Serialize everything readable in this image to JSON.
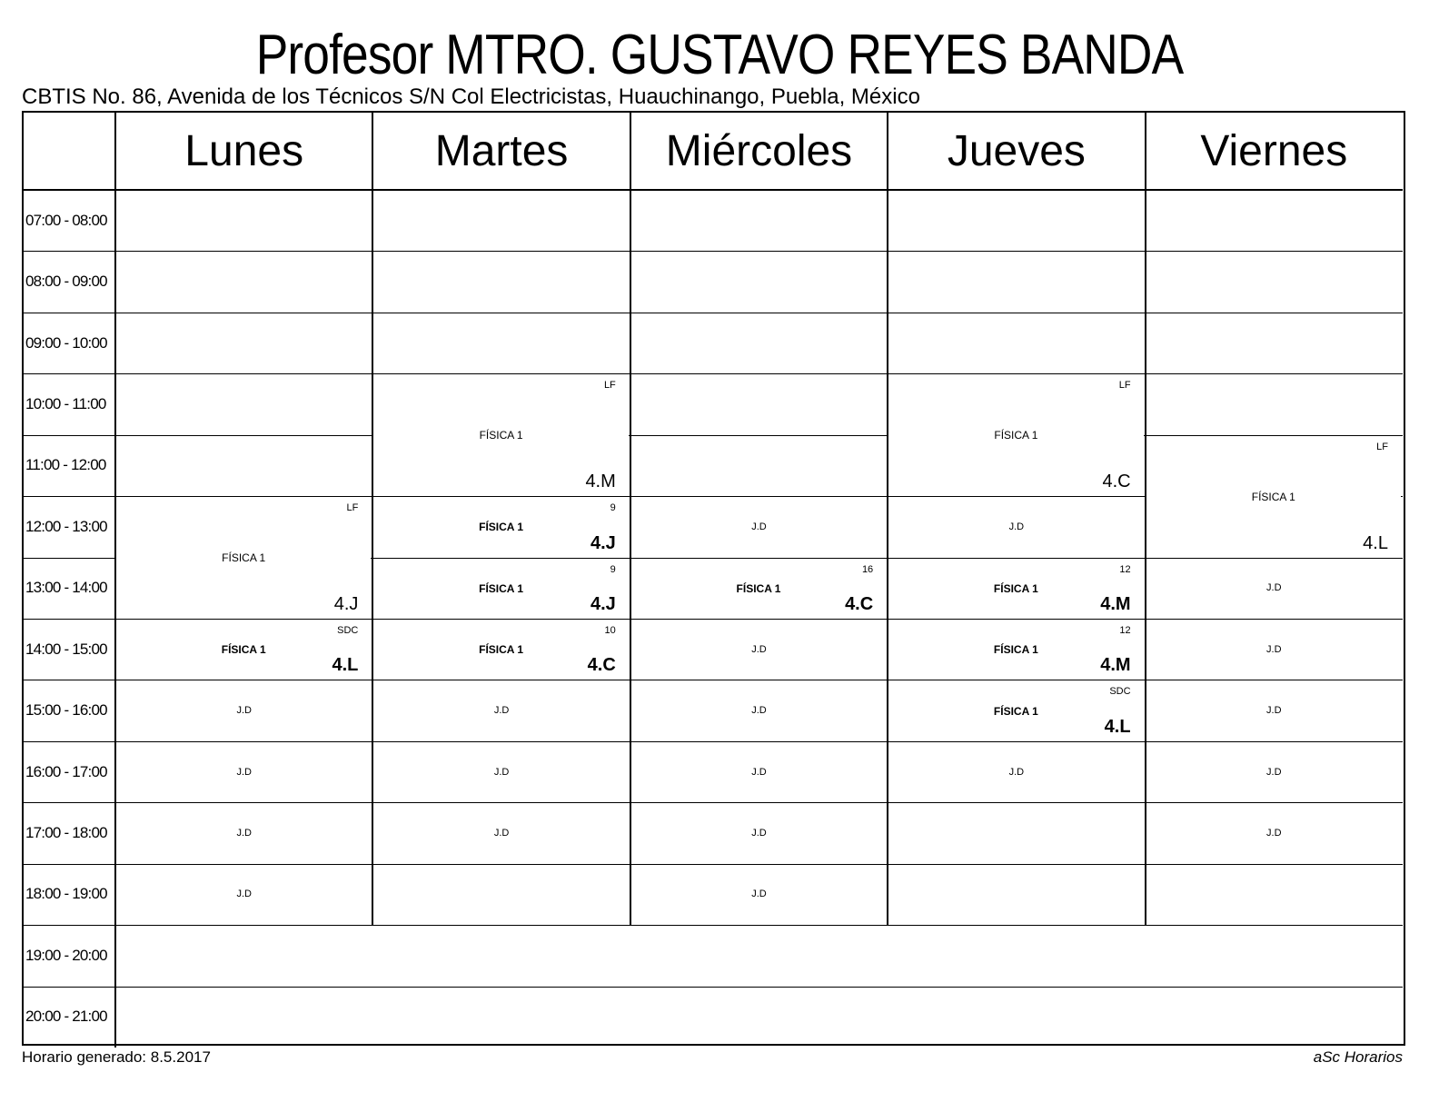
{
  "header": {
    "title": "Profesor MTRO. GUSTAVO REYES BANDA",
    "subtitle": "CBTIS No. 86, Avenida de los Técnicos S/N Col Electricistas, Huauchinango, Puebla, México"
  },
  "days": [
    "Lunes",
    "Martes",
    "Miércoles",
    "Jueves",
    "Viernes"
  ],
  "times": [
    "07:00 - 08:00",
    "08:00 - 09:00",
    "09:00 - 10:00",
    "10:00 - 11:00",
    "11:00 - 12:00",
    "12:00 - 13:00",
    "13:00 - 14:00",
    "14:00 - 15:00",
    "15:00 - 16:00",
    "16:00 - 17:00",
    "17:00 - 18:00",
    "18:00 - 19:00",
    "19:00 - 20:00",
    "20:00 - 21:00"
  ],
  "grid_rows": 12,
  "lessons": [
    {
      "day": 1,
      "start": 3,
      "span": 2,
      "subject": "FÍSICA 1",
      "room": "LF",
      "group": "4.M",
      "bold": false
    },
    {
      "day": 3,
      "start": 3,
      "span": 2,
      "subject": "FÍSICA 1",
      "room": "LF",
      "group": "4.C",
      "bold": false
    },
    {
      "day": 4,
      "start": 4,
      "span": 2,
      "subject": "FÍSICA 1",
      "room": "LF",
      "group": "4.L",
      "bold": false
    },
    {
      "day": 0,
      "start": 5,
      "span": 2,
      "subject": "FÍSICA 1",
      "room": "LF",
      "group": "4.J",
      "bold": false
    },
    {
      "day": 1,
      "start": 5,
      "span": 1,
      "subject": "FÍSICA 1",
      "room": "9",
      "group": "4.J",
      "bold": true
    },
    {
      "day": 1,
      "start": 6,
      "span": 1,
      "subject": "FÍSICA 1",
      "room": "9",
      "group": "4.J",
      "bold": true
    },
    {
      "day": 2,
      "start": 6,
      "span": 1,
      "subject": "FÍSICA 1",
      "room": "16",
      "group": "4.C",
      "bold": true
    },
    {
      "day": 3,
      "start": 6,
      "span": 1,
      "subject": "FÍSICA 1",
      "room": "12",
      "group": "4.M",
      "bold": true
    },
    {
      "day": 0,
      "start": 7,
      "span": 1,
      "subject": "FÍSICA 1",
      "room": "SDC",
      "group": "4.L",
      "bold": true
    },
    {
      "day": 1,
      "start": 7,
      "span": 1,
      "subject": "FÍSICA 1",
      "room": "10",
      "group": "4.C",
      "bold": true
    },
    {
      "day": 3,
      "start": 7,
      "span": 1,
      "subject": "FÍSICA 1",
      "room": "12",
      "group": "4.M",
      "bold": true
    },
    {
      "day": 3,
      "start": 8,
      "span": 1,
      "subject": "FÍSICA 1",
      "room": "SDC",
      "group": "4.L",
      "bold": true
    }
  ],
  "duties": [
    {
      "day": 2,
      "row": 5,
      "label": "J.D"
    },
    {
      "day": 3,
      "row": 5,
      "label": "J.D"
    },
    {
      "day": 4,
      "row": 6,
      "label": "J.D"
    },
    {
      "day": 2,
      "row": 7,
      "label": "J.D"
    },
    {
      "day": 4,
      "row": 7,
      "label": "J.D"
    },
    {
      "day": 0,
      "row": 8,
      "label": "J.D"
    },
    {
      "day": 1,
      "row": 8,
      "label": "J.D"
    },
    {
      "day": 2,
      "row": 8,
      "label": "J.D"
    },
    {
      "day": 4,
      "row": 8,
      "label": "J.D"
    },
    {
      "day": 0,
      "row": 9,
      "label": "J.D"
    },
    {
      "day": 1,
      "row": 9,
      "label": "J.D"
    },
    {
      "day": 2,
      "row": 9,
      "label": "J.D"
    },
    {
      "day": 3,
      "row": 9,
      "label": "J.D"
    },
    {
      "day": 4,
      "row": 9,
      "label": "J.D"
    },
    {
      "day": 0,
      "row": 10,
      "label": "J.D"
    },
    {
      "day": 1,
      "row": 10,
      "label": "J.D"
    },
    {
      "day": 2,
      "row": 10,
      "label": "J.D"
    },
    {
      "day": 4,
      "row": 10,
      "label": "J.D"
    },
    {
      "day": 0,
      "row": 11,
      "label": "J.D"
    },
    {
      "day": 2,
      "row": 11,
      "label": "J.D"
    }
  ],
  "footer": {
    "generated": "Horario generado: 8.5.2017",
    "brand": "aSc Horarios"
  }
}
